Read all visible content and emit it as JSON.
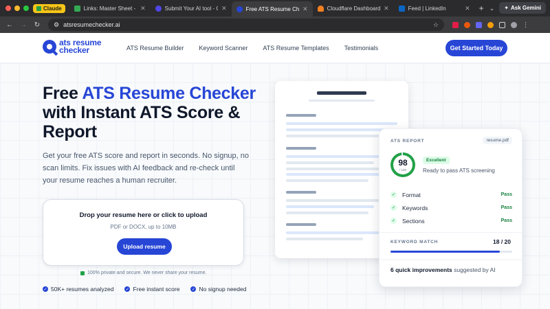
{
  "browser": {
    "claude_label": "Claude",
    "tabs": [
      {
        "title": "Links: Master Sheet - Go",
        "color": "#34a853",
        "active": false
      },
      {
        "title": "Submit Your AI tool - Go",
        "color": "#4f46e5",
        "active": false
      },
      {
        "title": "Free ATS Resume Checker",
        "color": "#2746d6",
        "active": true
      },
      {
        "title": "Cloudflare Dashboard | M",
        "color": "#f38020",
        "active": false
      },
      {
        "title": "Feed | LinkedIn",
        "color": "#0a66c2",
        "active": false
      }
    ],
    "new_tab": "+",
    "ask_gemini": "Ask Gemini",
    "url": "atsresumechecker.ai"
  },
  "header": {
    "logo_line1": "ats resume",
    "logo_line2": "checker",
    "nav": [
      "ATS Resume Builder",
      "Keyword Scanner",
      "ATS Resume Templates",
      "Testimonials"
    ],
    "cta": "Get Started Today"
  },
  "hero": {
    "title_part1": "Free ",
    "title_accent": "ATS Resume Checker",
    "title_part2": " with Instant ATS Score & Report",
    "lede": "Get your free ATS score and report in seconds. No signup, no scan limits. Fix issues with AI feedback and re-check until your resume reaches a human recruiter.",
    "upload": {
      "title": "Drop your resume here or click to upload",
      "sub": "PDF or DOCX, up to 10MB",
      "button": "Upload resume"
    },
    "privacy": "100% private and secure. We never share your resume.",
    "trust": [
      "50K+ resumes analyzed",
      "Free instant score",
      "No signup needed"
    ]
  },
  "report": {
    "label": "ATS REPORT",
    "file": "resume.pdf",
    "score": "98",
    "score_max": "/ 100",
    "badge": "Excellent",
    "status": "Ready to pass ATS screening",
    "checks": [
      {
        "name": "Format",
        "result": "Pass"
      },
      {
        "name": "Keywords",
        "result": "Pass"
      },
      {
        "name": "Sections",
        "result": "Pass"
      }
    ],
    "keyword_label": "KEYWORD MATCH",
    "keyword_count": "18 / 20",
    "keyword_ratio": 0.9,
    "improve_bold": "6 quick improvements",
    "improve_rest": " suggested by AI"
  }
}
